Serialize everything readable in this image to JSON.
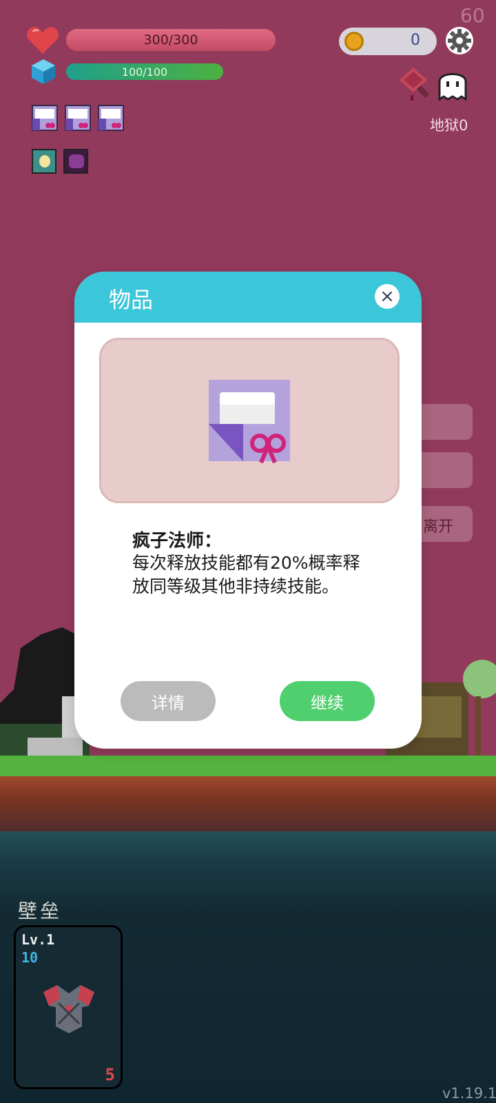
{
  "hud": {
    "fps": "60",
    "hp_text": "300/300",
    "hp_fraction": 1.0,
    "mp_text": "100/100",
    "mp_fraction": 1.0,
    "coins": "0",
    "difficulty_label": "地狱0"
  },
  "icons": {
    "heart": "heart-icon",
    "gem": "gem-icon",
    "coin": "coin-icon",
    "settings": "gear-icon",
    "cleaver": "cleaver-icon",
    "ghost": "ghost-icon"
  },
  "buffs": [
    "gift-buff-icon",
    "gift-buff-icon",
    "gift-buff-icon"
  ],
  "skills": [
    "lightbulb-skill-icon",
    "demon-skill-icon"
  ],
  "side_menu": {
    "item3_label": "离开"
  },
  "dialog": {
    "title": "物品",
    "close": "×",
    "item_name": "疯子法师：",
    "item_description": "每次释放技能都有20%概率释放同等级其他非持续技能。",
    "details_label": "详情",
    "continue_label": "继续"
  },
  "bottom": {
    "section_title": "壁垒",
    "card_level": "Lv.1",
    "card_power": "10",
    "card_count": "5",
    "version": "v1.19.1"
  },
  "colors": {
    "background": "#923a5c",
    "dialog_header": "#3cc6d9",
    "continue_button": "#4fcf6e",
    "details_button": "#bbbbbb",
    "hp_bar": "#d25a76",
    "mp_bar": "#2aa07c"
  }
}
